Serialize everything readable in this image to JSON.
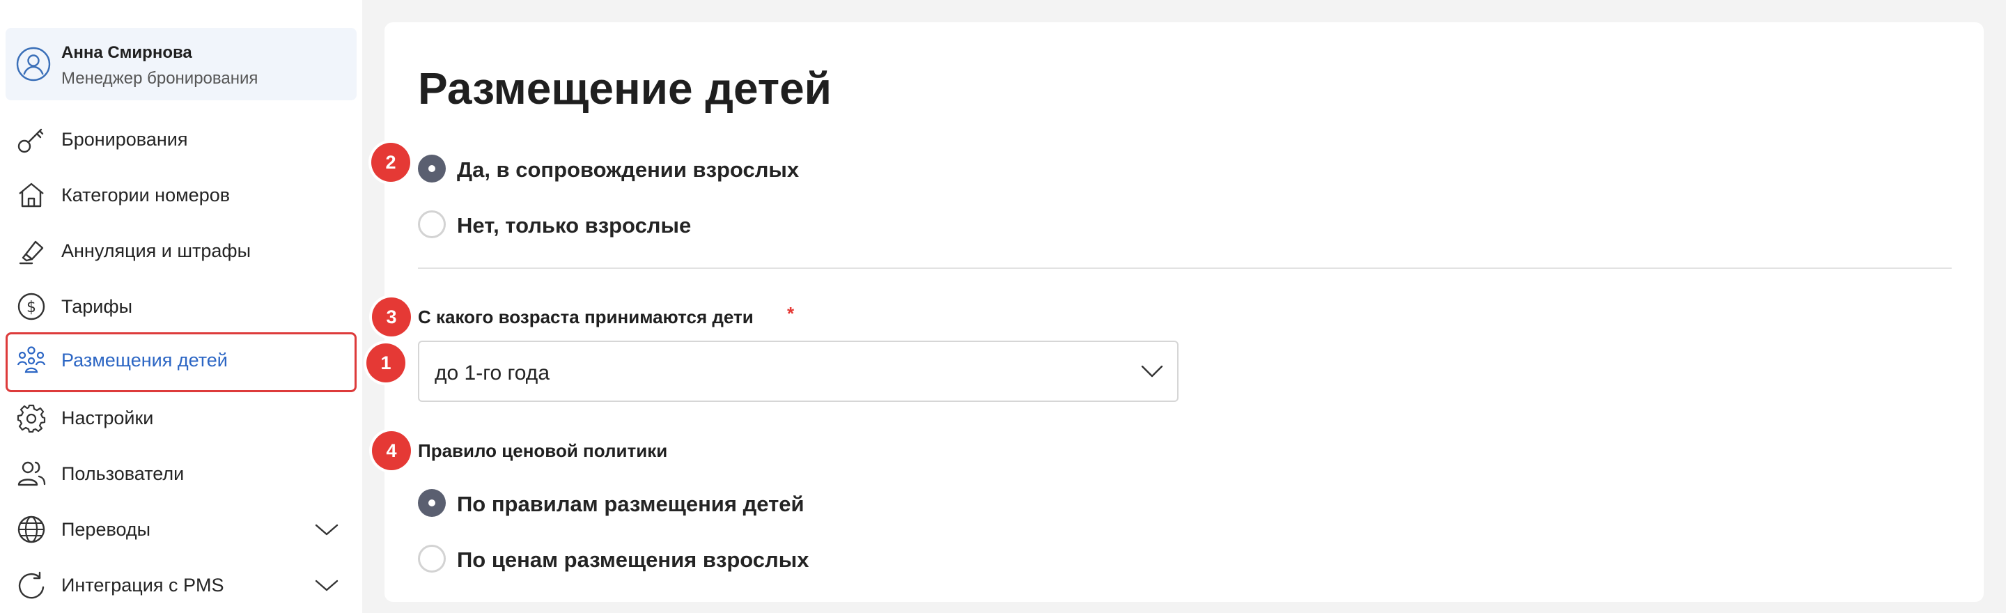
{
  "user": {
    "name": "Анна Смирнова",
    "role": "Менеджер бронирования"
  },
  "nav": {
    "items": [
      {
        "label": "Бронирования",
        "icon": "key-icon"
      },
      {
        "label": "Категории номеров",
        "icon": "home-icon"
      },
      {
        "label": "Аннуляция и штрафы",
        "icon": "eraser-icon"
      },
      {
        "label": "Тарифы",
        "icon": "dollar-circle-icon"
      },
      {
        "label": "Размещения детей",
        "icon": "people-group-icon",
        "active": true
      },
      {
        "label": "Настройки",
        "icon": "gear-icon"
      },
      {
        "label": "Пользователи",
        "icon": "users-icon"
      },
      {
        "label": "Переводы",
        "icon": "globe-icon",
        "expandable": true
      },
      {
        "label": "Интеграция с PMS",
        "icon": "sync-icon",
        "expandable": true
      }
    ]
  },
  "main": {
    "title": "Размещение детей",
    "accommodation": {
      "options": [
        {
          "label": "Да, в сопровождении взрослых",
          "checked": true
        },
        {
          "label": "Нет, только взрослые",
          "checked": false
        }
      ]
    },
    "age_field": {
      "label": "С какого возраста принимаются дети",
      "required_mark": "*",
      "value": "до 1-го года"
    },
    "pricing": {
      "label": "Правило ценовой политики",
      "options": [
        {
          "label": "По правилам размещения детей",
          "checked": true
        },
        {
          "label": "По ценам размещения взрослых",
          "checked": false
        }
      ]
    }
  },
  "badges": [
    "1",
    "2",
    "3",
    "4"
  ],
  "colors": {
    "accent": "#2c66c4",
    "highlight_border": "#dd3b3b",
    "badge": "#e53935",
    "radio_checked": "#5a5f70"
  }
}
